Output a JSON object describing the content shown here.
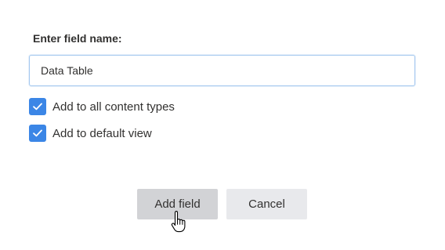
{
  "form": {
    "field_label": "Enter field name:",
    "field_value": "Data Table",
    "checkboxes": [
      {
        "label": "Add to all content types",
        "checked": true
      },
      {
        "label": "Add to default view",
        "checked": true
      }
    ]
  },
  "buttons": {
    "add_label": "Add field",
    "cancel_label": "Cancel"
  },
  "colors": {
    "checkbox_accent": "#3b86e6",
    "add_button_bg": "#d2d3d6",
    "cancel_button_bg": "#e8e9ec",
    "input_border": "#a3c8ef"
  },
  "icons": {
    "check": "checkmark-icon",
    "pointer": "hand-pointer-cursor-icon"
  }
}
